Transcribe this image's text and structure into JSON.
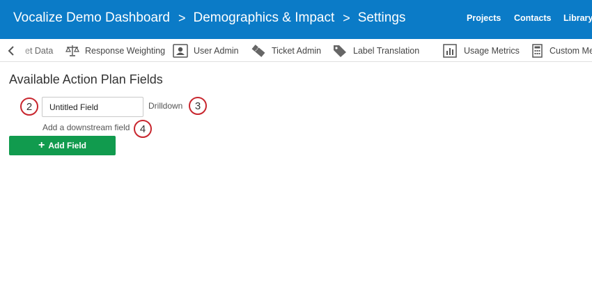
{
  "header": {
    "breadcrumbs": [
      "Vocalize Demo Dashboard",
      "Demographics & Impact",
      "Settings"
    ],
    "separator": ">",
    "nav": [
      "Projects",
      "Contacts",
      "Library"
    ]
  },
  "toolbar": {
    "items": [
      {
        "label": "et Data",
        "icon": "data-icon"
      },
      {
        "label": "Response Weighting",
        "icon": "scale-icon"
      },
      {
        "label": "User Admin",
        "icon": "user-card-icon"
      },
      {
        "label": "Ticket Admin",
        "icon": "ticket-icon"
      },
      {
        "label": "Label Translation",
        "icon": "tag-icon"
      },
      {
        "label": "Usage Metrics",
        "icon": "bar-chart-icon"
      },
      {
        "label": "Custom Me",
        "icon": "calculator-icon"
      }
    ]
  },
  "main": {
    "title": "Available Action Plan Fields",
    "field_value": "Untitled Field",
    "drilldown_label": "Drilldown",
    "downstream_link": "Add a downstream field",
    "add_button": "Add Field",
    "add_icon": "+",
    "markers": [
      "2",
      "3",
      "4"
    ]
  },
  "colors": {
    "header_bg": "#0b7bc7",
    "button_bg": "#119b4e",
    "marker_border": "#c8262e"
  }
}
